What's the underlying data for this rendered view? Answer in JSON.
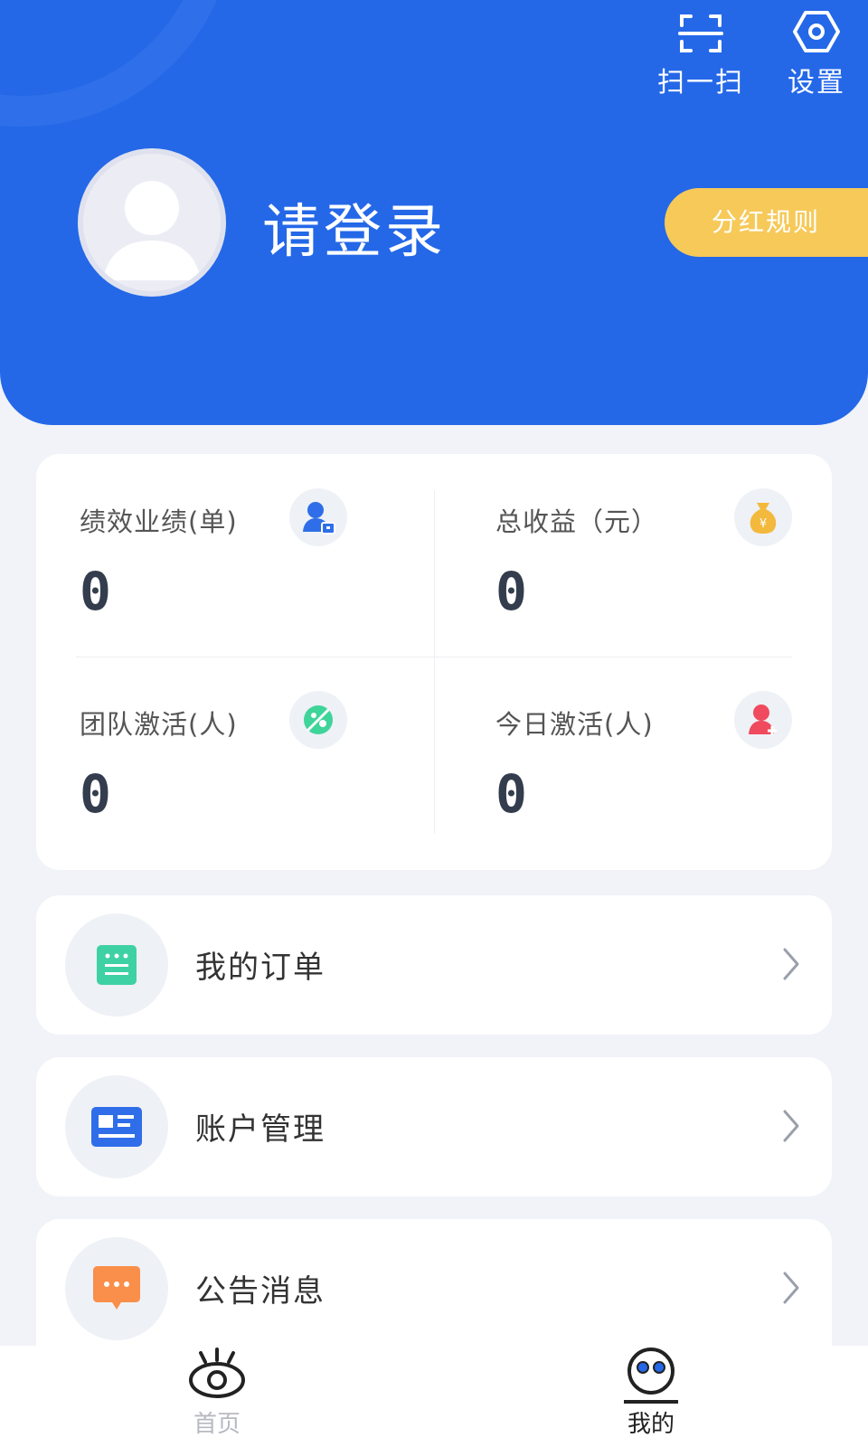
{
  "header": {
    "scan_label": "扫一扫",
    "settings_label": "设置",
    "login_text": "请登录",
    "dividend_rule_label": "分红规则"
  },
  "stats": [
    {
      "label": "绩效业绩(单)",
      "value": "0",
      "icon": "user-badge-icon",
      "color": "#2f6ee8"
    },
    {
      "label": "总收益（元）",
      "value": "0",
      "icon": "money-bag-icon",
      "color": "#f3b93c"
    },
    {
      "label": "团队激活(人)",
      "value": "0",
      "icon": "leaf-icon",
      "color": "#3fd49a"
    },
    {
      "label": "今日激活(人)",
      "value": "0",
      "icon": "add-user-icon",
      "color": "#f04a5e"
    }
  ],
  "menu": [
    {
      "label": "我的订单",
      "icon": "order-list-icon",
      "color": "#3ed1a4"
    },
    {
      "label": "账户管理",
      "icon": "id-card-icon",
      "color": "#2f6ee8"
    },
    {
      "label": "公告消息",
      "icon": "message-icon",
      "color": "#f98f4b"
    }
  ],
  "tabbar": {
    "home_label": "首页",
    "mine_label": "我的"
  },
  "colors": {
    "primary": "#2468e8",
    "accent": "#f6c959",
    "background": "#f1f3f8"
  }
}
